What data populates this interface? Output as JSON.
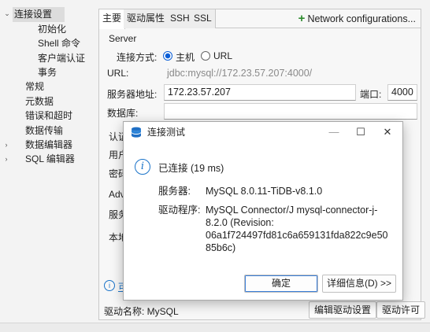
{
  "nav": {
    "items": [
      {
        "label": "连接设置",
        "expanded": true,
        "selected": true
      },
      {
        "label": "初始化"
      },
      {
        "label": "Shell 命令"
      },
      {
        "label": "客户端认证"
      },
      {
        "label": "事务"
      },
      {
        "label": "常规"
      },
      {
        "label": "元数据"
      },
      {
        "label": "错误和超时"
      },
      {
        "label": "数据传输"
      },
      {
        "label": "数据编辑器",
        "collapsed": true
      },
      {
        "label": "SQL 编辑器",
        "collapsed": true
      }
    ]
  },
  "tabs": [
    {
      "label": "主要",
      "active": true
    },
    {
      "label": "驱动属性"
    },
    {
      "label": "SSH"
    },
    {
      "label": "SSL"
    }
  ],
  "network_config": {
    "label": "Network configurations..."
  },
  "server": {
    "group_label": "Server",
    "connect_method_label": "连接方式:",
    "option_host": "主机",
    "option_url": "URL",
    "url_label": "URL:",
    "url_value": "jdbc:mysql://172.23.57.207:4000/",
    "host_label": "服务器地址:",
    "host_value": "172.23.57.207",
    "port_label": "端口:",
    "port_value": "4000",
    "db_label": "数据库:",
    "db_value": ""
  },
  "auth": {
    "group_label_partial": "认证",
    "user_label_partial": "用户",
    "password_label_partial": "密码"
  },
  "advanced": {
    "group_label_partial": "Adv",
    "row1_partial": "服务",
    "row2_partial": "本地"
  },
  "footer": {
    "info_link_partial": "可",
    "driver_name_label": "驱动名称: MySQL",
    "edit_driver_label": "编辑驱动设置",
    "driver_license_label": "驱动许可"
  },
  "dialog": {
    "title": "连接测试",
    "status": "已连接 (19 ms)",
    "server_label": "服务器:",
    "server_value": "MySQL 8.0.11-TiDB-v8.1.0",
    "driver_label": "驱动程序:",
    "driver_line1": "MySQL Connector/J mysql-connector-j-",
    "driver_line2": "8.2.0 (Revision:",
    "driver_line3": "06a1f724497fd81c6a659131fda822c9e50",
    "driver_line4": "85b6c)",
    "ok_label": "确定",
    "details_label": "详细信息(D) >>",
    "minimize_glyph": "—",
    "maximize_glyph": "☐",
    "close_glyph": "✕"
  },
  "colors": {
    "accent": "#0b5ed7",
    "plus_green": "#2e8b2e",
    "info_blue": "#1a73c9",
    "db_icon_blue": "#1f6fc5"
  }
}
